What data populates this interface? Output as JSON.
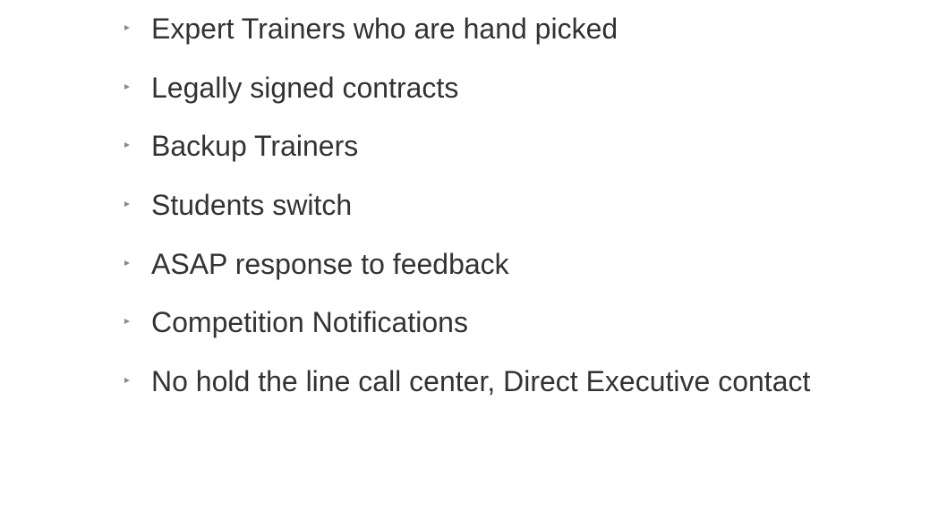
{
  "slide": {
    "bullet_marker_icon": "triangle-right-icon",
    "colors": {
      "text": "#333333",
      "marker": "#888888",
      "background": "#ffffff"
    },
    "items": [
      {
        "text": "Expert Trainers who are hand picked"
      },
      {
        "text": "Legally signed contracts"
      },
      {
        "text": "Backup Trainers"
      },
      {
        "text": "Students switch"
      },
      {
        "text": "ASAP response to feedback"
      },
      {
        "text": "Competition Notifications"
      },
      {
        "text": "No hold the line call center, Direct Executive contact"
      }
    ]
  }
}
